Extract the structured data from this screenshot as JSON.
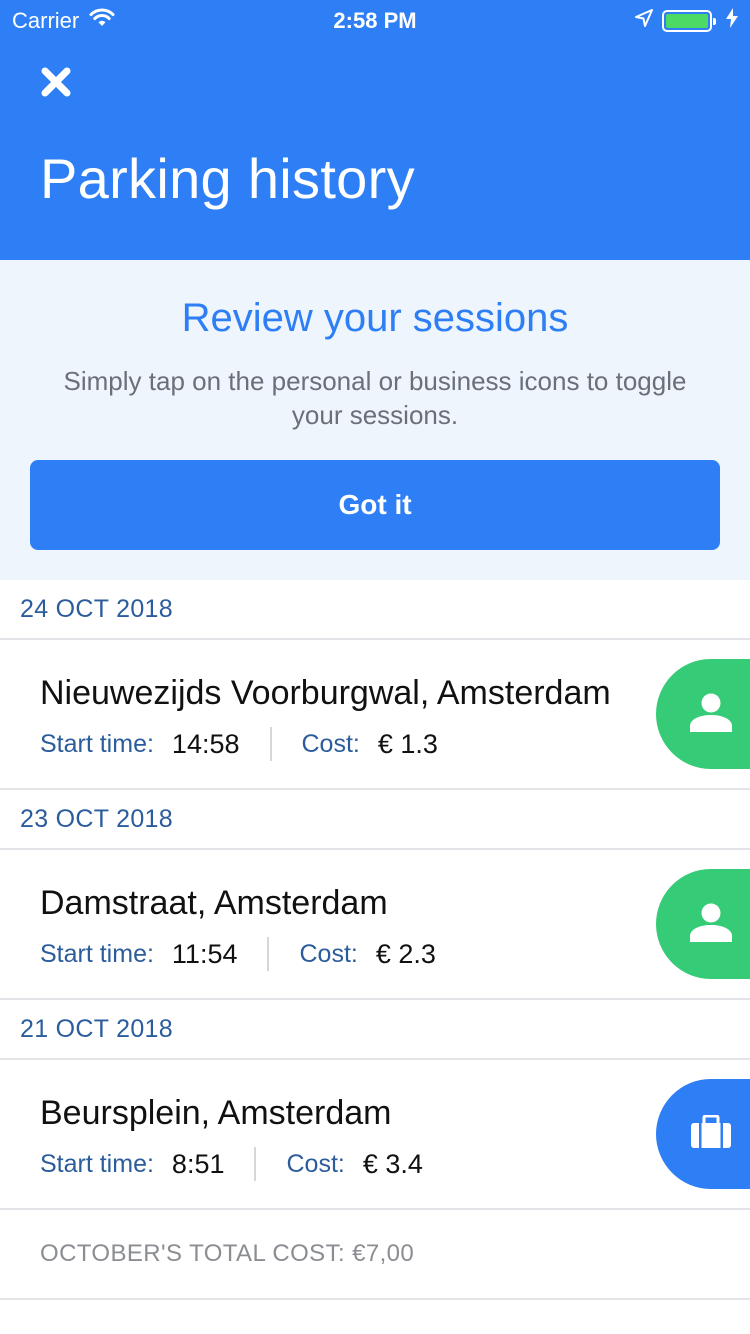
{
  "status_bar": {
    "carrier": "Carrier",
    "time": "2:58 PM",
    "battery_color": "#4cd964"
  },
  "header": {
    "title": "Parking history",
    "close_icon": "close-icon",
    "background": "#2e7ff5"
  },
  "tip": {
    "title": "Review your sessions",
    "body": "Simply tap on the personal or business icons to toggle your sessions.",
    "button_label": "Got it"
  },
  "sessions": [
    {
      "date": "24 OCT 2018",
      "location": "Nieuwezijds Voorburgwal, Amsterdam",
      "start_label": "Start time:",
      "start_time": "14:58",
      "cost_label": "Cost:",
      "cost": "€ 1.3",
      "type": "personal",
      "icon": "person-icon",
      "color": "#36cb76"
    },
    {
      "date": "23 OCT 2018",
      "location": "Damstraat, Amsterdam",
      "start_label": "Start time:",
      "start_time": "11:54",
      "cost_label": "Cost:",
      "cost": "€ 2.3",
      "type": "personal",
      "icon": "person-icon",
      "color": "#36cb76"
    },
    {
      "date": "21 OCT 2018",
      "location": "Beursplein, Amsterdam",
      "start_label": "Start time:",
      "start_time": "8:51",
      "cost_label": "Cost:",
      "cost": "€ 3.4",
      "type": "business",
      "icon": "briefcase-icon",
      "color": "#2e7ff5"
    }
  ],
  "total": {
    "label": "OCTOBER'S TOTAL COST: €7,00"
  }
}
